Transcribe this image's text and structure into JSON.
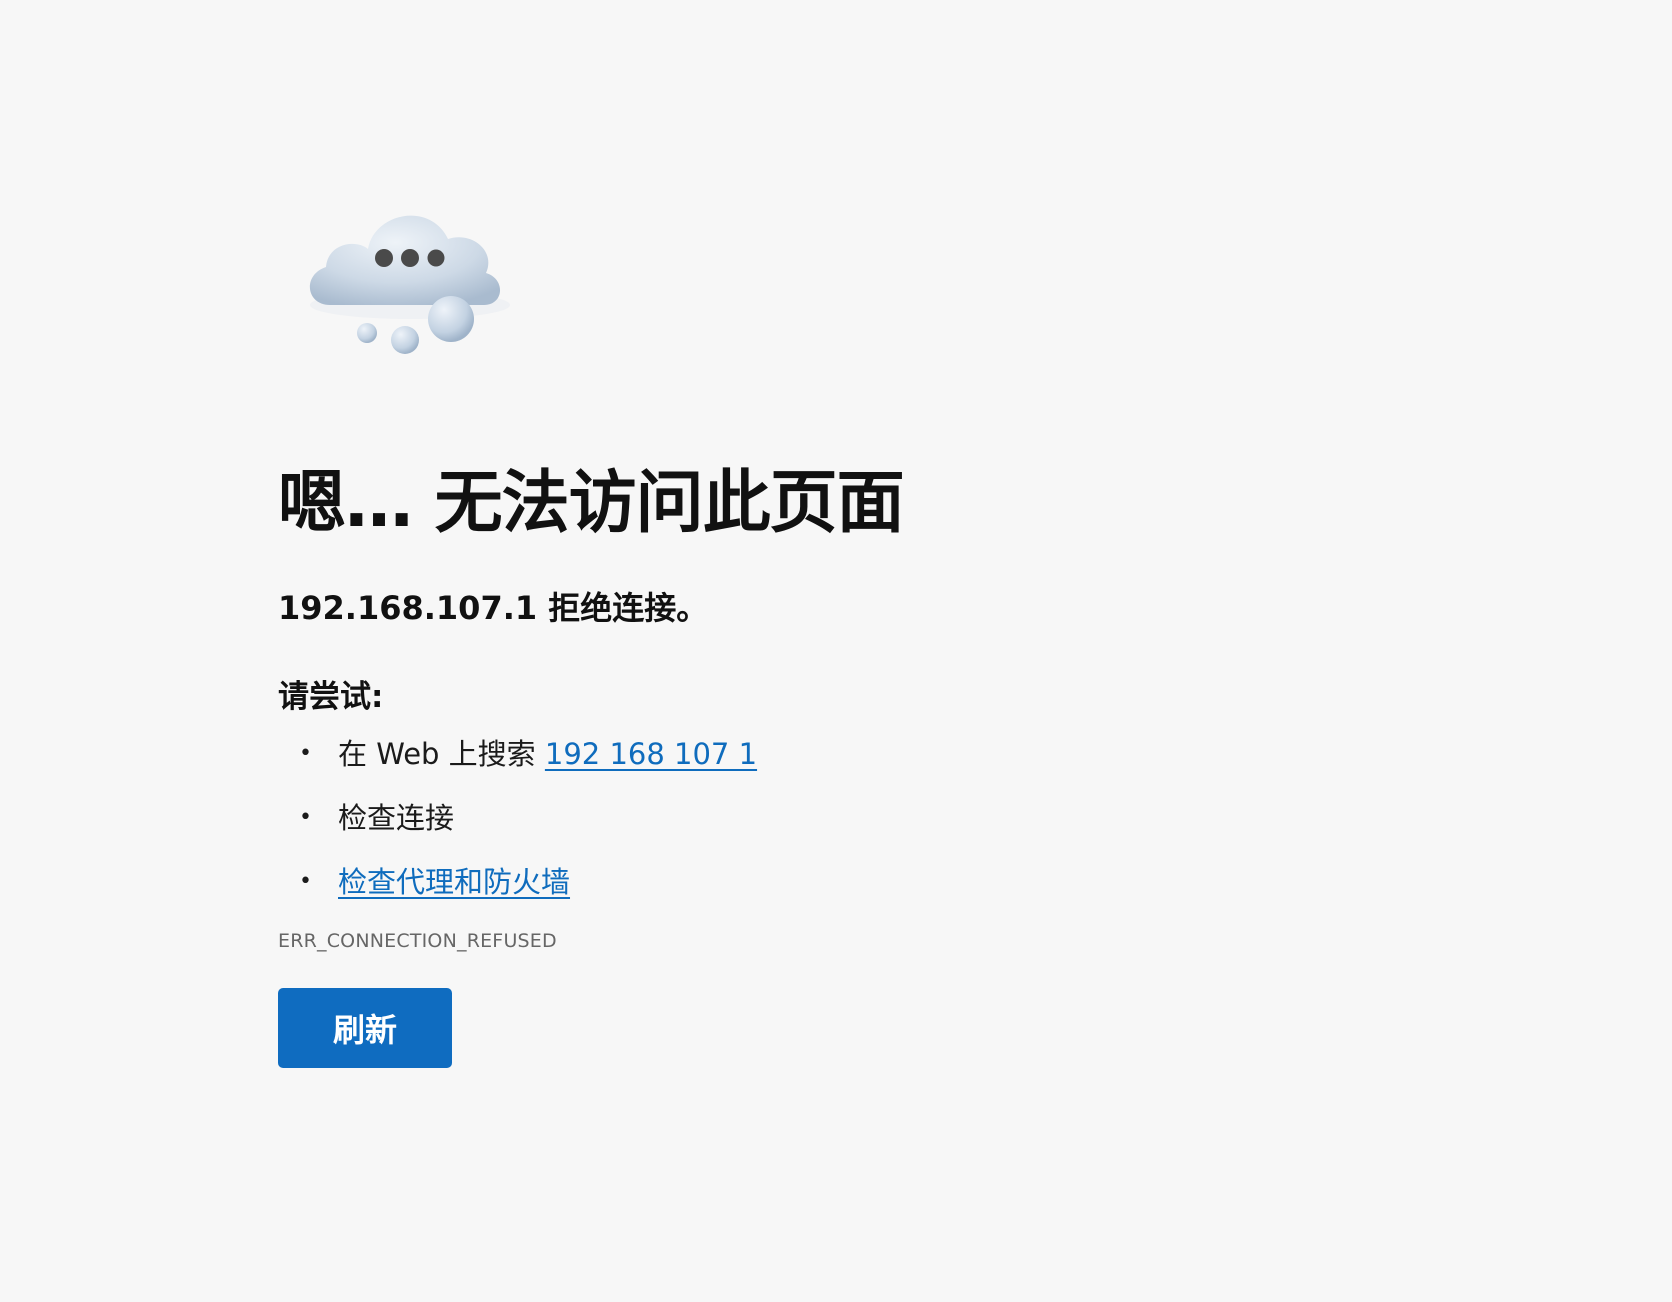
{
  "illustration": {
    "icon": "cloud-thinking-icon"
  },
  "error": {
    "title": "嗯… 无法访问此页面",
    "message": "192.168.107.1 拒绝连接。",
    "try_heading": "请尝试:",
    "suggestions": [
      {
        "prefix": "在 Web 上搜索 ",
        "link": "192 168 107 1"
      },
      {
        "prefix": "检查连接",
        "link": ""
      },
      {
        "prefix": "",
        "link": "检查代理和防火墙"
      }
    ],
    "code": "ERR_CONNECTION_REFUSED"
  },
  "actions": {
    "refresh_label": "刷新"
  },
  "colors": {
    "background": "#f7f7f7",
    "link": "#0f6cbd",
    "button": "#0f6cc0"
  }
}
